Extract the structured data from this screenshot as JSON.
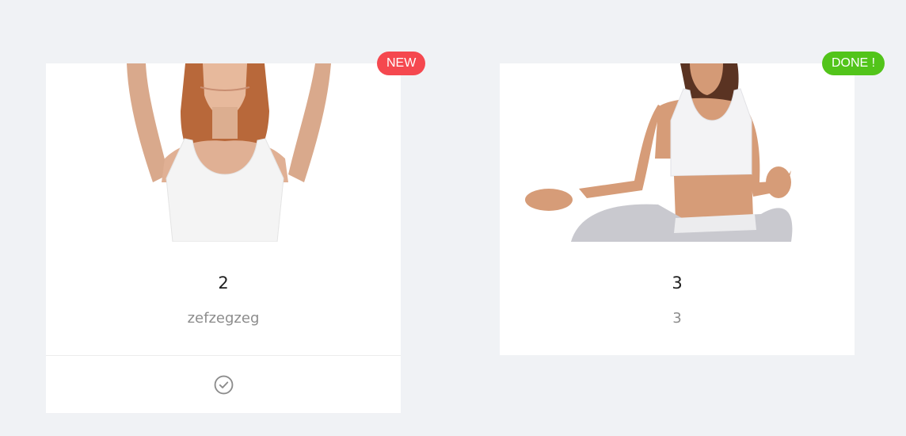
{
  "colors": {
    "background": "#f0f2f5",
    "card": "#ffffff",
    "badge_new": "#f5484f",
    "badge_done": "#52c41a",
    "icon": "#8c8c8c"
  },
  "cards": [
    {
      "title": "2",
      "description": "zefzegzeg",
      "badge": "NEW",
      "image": "woman-arms-raised-photo",
      "action_icon": "check-circle-icon"
    },
    {
      "title": "3",
      "description": "3",
      "badge": "DONE !",
      "image": "woman-yoga-meditation-photo"
    }
  ]
}
